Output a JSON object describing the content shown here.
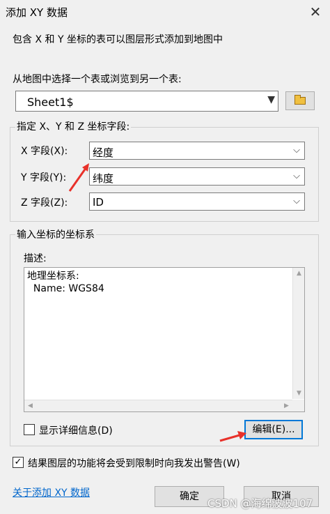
{
  "window": {
    "title": "添加 XY 数据",
    "close_glyph": "✕"
  },
  "intro_text": "包含 X 和 Y 坐标的表可以图层形式添加到地图中",
  "table_select": {
    "label": "从地图中选择一个表或浏览到另一个表:",
    "value": "Sheet1$"
  },
  "fields_group": {
    "title": "指定 X、Y 和 Z 坐标字段:",
    "x": {
      "label": "X 字段(X):",
      "value": "经度"
    },
    "y": {
      "label": "Y 字段(Y):",
      "value": "纬度"
    },
    "z": {
      "label": "Z 字段(Z):",
      "value": "ID"
    }
  },
  "crs_group": {
    "title": "输入坐标的坐标系",
    "desc_label": "描述:",
    "desc_text": "地理坐标系:\n  Name: WGS84",
    "show_details": {
      "label": "显示详细信息(D)",
      "checked": false
    },
    "edit_button": "编辑(E)..."
  },
  "warn_checkbox": {
    "label": "结果图层的功能将会受到限制时向我发出警告(W)",
    "checked": true
  },
  "about_link": "关于添加 XY 数据",
  "ok_button": "确定",
  "cancel_button": "取消",
  "watermark": "CSDN @海绵波波107",
  "icons": {
    "dropdown": "chevron-down-icon",
    "folder": "folder-open-icon"
  },
  "colors": {
    "accent": "#0078d7",
    "annotation_arrow": "#e8312a",
    "link": "#0066cc"
  }
}
